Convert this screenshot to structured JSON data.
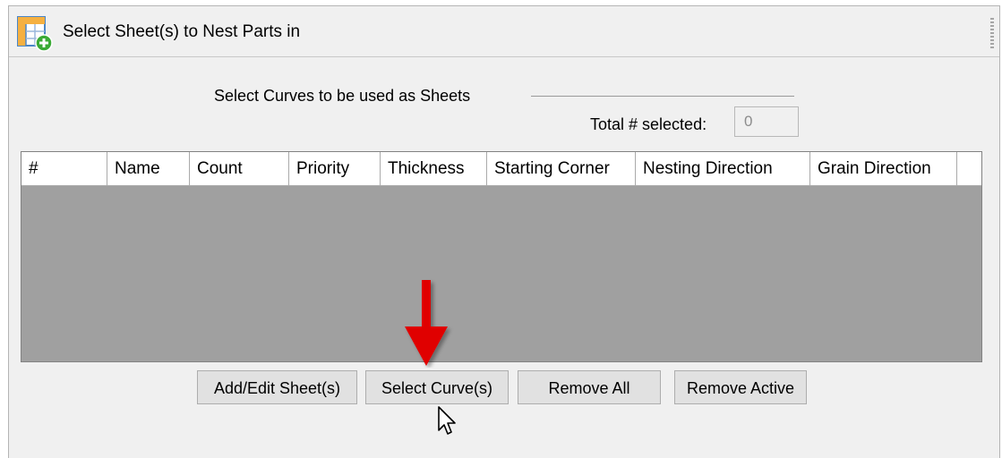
{
  "window": {
    "title": "Select Sheet(s) to Nest Parts in",
    "icon": "sheet-add-icon"
  },
  "selection": {
    "prompt": "Select Curves to be used as Sheets",
    "total_label": "Total # selected:",
    "total_value": "0"
  },
  "table": {
    "columns": [
      "#",
      "Name",
      "Count",
      "Priority",
      "Thickness",
      "Starting Corner",
      "Nesting Direction",
      "Grain Direction"
    ],
    "rows": []
  },
  "buttons": {
    "add_edit": "Add/Edit Sheet(s)",
    "select_curves": "Select Curve(s)",
    "remove_all": "Remove All",
    "remove_active": "Remove Active"
  },
  "annotations": {
    "arrow_icon": "red-down-arrow-icon",
    "cursor_icon": "mouse-pointer-icon",
    "arrow_color": "#e00000"
  },
  "colors": {
    "panel_bg": "#f0f0f0",
    "table_body_bg": "#a0a0a0",
    "button_bg": "#e1e1e1"
  }
}
